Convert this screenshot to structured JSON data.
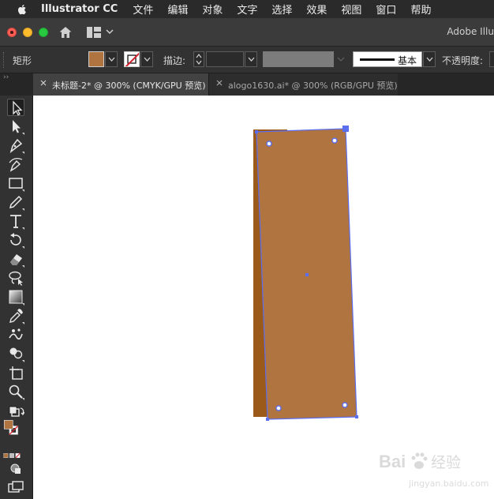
{
  "menubar": {
    "app_name": "Illustrator CC",
    "items": [
      "文件",
      "编辑",
      "对象",
      "文字",
      "选择",
      "效果",
      "视图",
      "窗口",
      "帮助"
    ]
  },
  "titlebar": {
    "app_title": "Adobe Illu"
  },
  "controlbar": {
    "object_type": "矩形",
    "fill_color": "#b07440",
    "stroke_label": "描边:",
    "brush_label": "基本",
    "opacity_label": "不透明度:"
  },
  "tabs": [
    {
      "label": "未标题-2* @ 300% (CMYK/GPU 预览)",
      "active": true
    },
    {
      "label": "alogo1630.ai* @ 300% (RGB/GPU 预览)",
      "active": false
    }
  ],
  "toolbar": {
    "tools": [
      "selection",
      "direct-selection",
      "pen",
      "curvature",
      "rectangle",
      "pencil",
      "type",
      "rotate",
      "eraser",
      "lasso",
      "gradient",
      "eyedropper",
      "blend",
      "symbol-sprayer",
      "artboard",
      "zoom"
    ],
    "fill_color": "#b07440",
    "stroke_color": "none"
  },
  "artwork": {
    "front_color": "#b07440",
    "back_color": "#9c5a1a",
    "selection_color": "#5b6ef0"
  },
  "watermark": {
    "brand": "Bai",
    "brand_tail": "经验",
    "url": "jingyan.baidu.com"
  }
}
